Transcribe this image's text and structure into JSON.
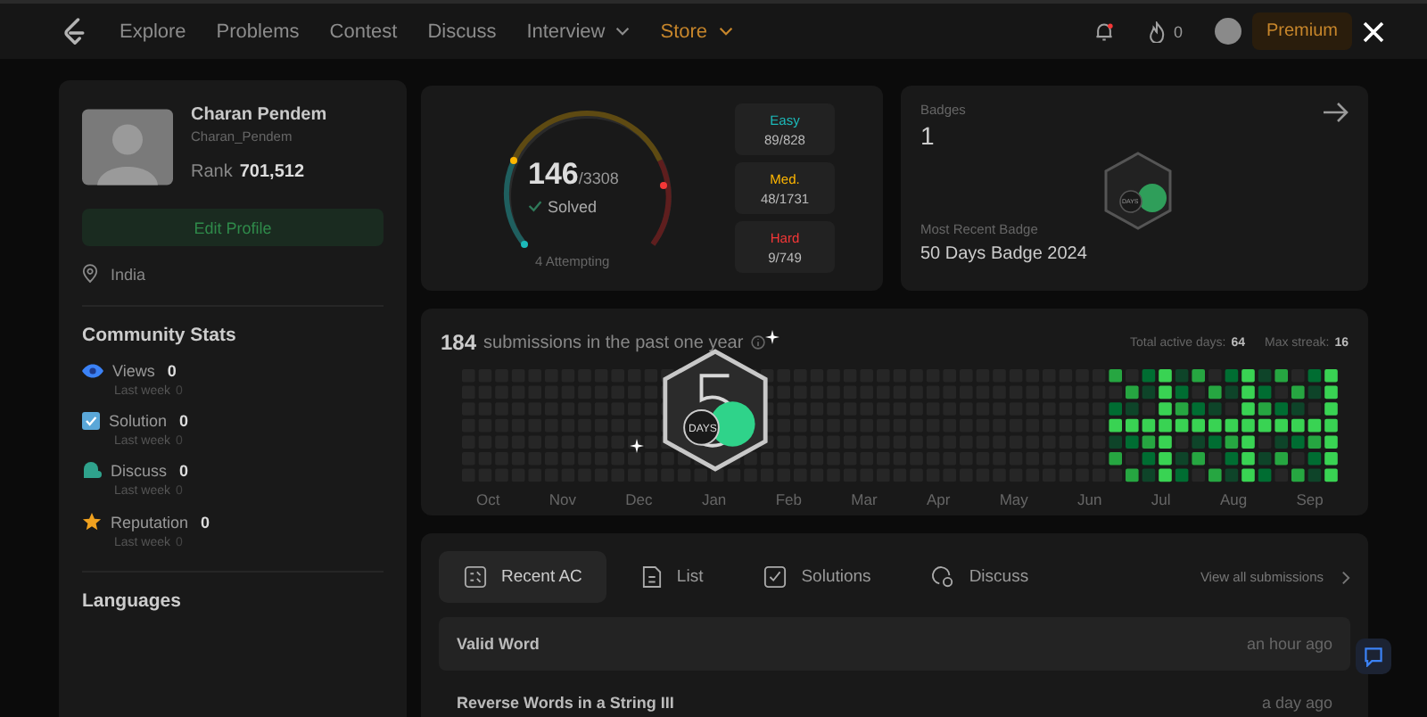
{
  "nav": {
    "links": [
      {
        "label": "Explore",
        "kind": "link",
        "highlight": false
      },
      {
        "label": "Problems",
        "kind": "link",
        "highlight": false
      },
      {
        "label": "Contest",
        "kind": "link",
        "highlight": false
      },
      {
        "label": "Discuss",
        "kind": "link",
        "highlight": false
      },
      {
        "label": "Interview",
        "kind": "dropdown",
        "highlight": false
      },
      {
        "label": "Store",
        "kind": "dropdown",
        "highlight": true
      }
    ],
    "streak": "0",
    "premium": "Premium"
  },
  "profile": {
    "name": "Charan Pendem",
    "username": "Charan_Pendem",
    "rank_label": "Rank",
    "rank": "701,512",
    "edit": "Edit Profile",
    "location": "India"
  },
  "community": {
    "title": "Community Stats",
    "stats": [
      {
        "kind": "views",
        "label": "Views",
        "value": "0",
        "sub": "Last week",
        "sub_value": "0"
      },
      {
        "kind": "solution",
        "label": "Solution",
        "value": "0",
        "sub": "Last week",
        "sub_value": "0"
      },
      {
        "kind": "discuss",
        "label": "Discuss",
        "value": "0",
        "sub": "Last week",
        "sub_value": "0"
      },
      {
        "kind": "reputation",
        "label": "Reputation",
        "value": "0",
        "sub": "Last week",
        "sub_value": "0"
      }
    ]
  },
  "languages": {
    "title": "Languages"
  },
  "solved": {
    "count": "146",
    "total": "/3308",
    "label": "Solved",
    "attempting": "4 Attempting",
    "levels": [
      {
        "label": "Easy",
        "value": "89/828",
        "color": "#1cbaba"
      },
      {
        "label": "Med.",
        "value": "48/1731",
        "color": "#ffb700"
      },
      {
        "label": "Hard",
        "value": "9/749",
        "color": "#f63737"
      }
    ]
  },
  "badges": {
    "title": "Badges",
    "count": "1",
    "badge_label": "DAYS",
    "recent_label": "Most Recent Badge",
    "recent": "50 Days Badge 2024"
  },
  "activity": {
    "count": "184",
    "text": "submissions in the past one year",
    "active_label": "Total active days:",
    "active": "64",
    "streak_label": "Max streak:",
    "streak": "16",
    "months": [
      "Oct",
      "Nov",
      "Dec",
      "Jan",
      "Feb",
      "Mar",
      "Apr",
      "May",
      "Jun",
      "Jul",
      "Aug",
      "Sep"
    ]
  },
  "tabs": [
    {
      "label": "Recent AC",
      "kind": "recent",
      "selected": true
    },
    {
      "label": "List",
      "kind": "list",
      "selected": false
    },
    {
      "label": "Solutions",
      "kind": "solutions",
      "selected": false
    },
    {
      "label": "Discuss",
      "kind": "discuss",
      "selected": false
    }
  ],
  "view_all": "View all submissions",
  "submissions": [
    {
      "title": "Valid Word",
      "time": "an hour ago"
    },
    {
      "title": "Reverse Words in a String III",
      "time": "a day ago"
    }
  ],
  "popup": {
    "badge_label": "DAYS"
  }
}
